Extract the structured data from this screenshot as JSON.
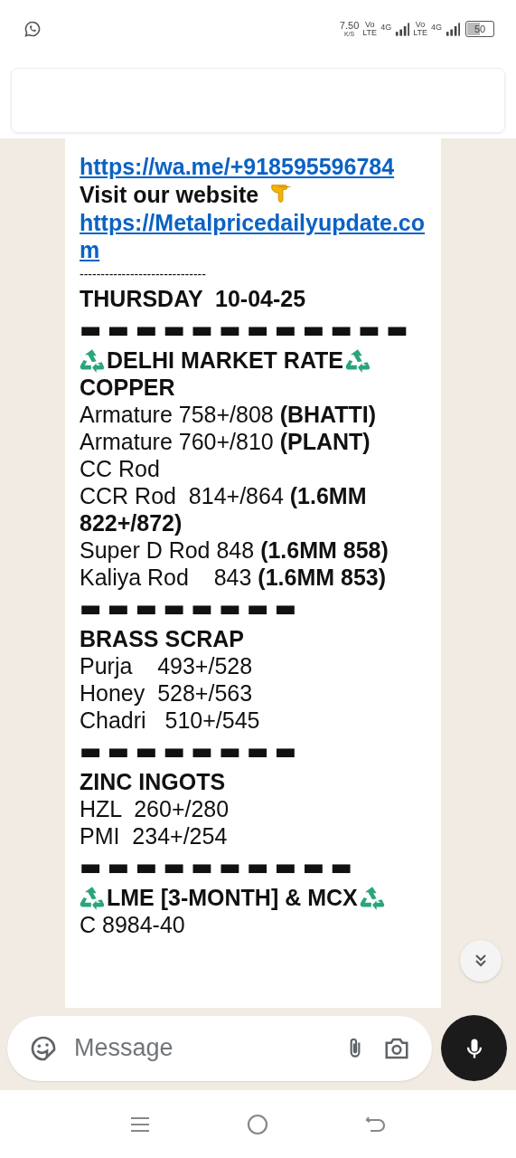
{
  "status_bar": {
    "speed": "7.50",
    "speed_unit": "K/S",
    "sims": [
      {
        "volte_top": "Vo",
        "volte_bottom": "LTE",
        "network": "4G"
      },
      {
        "volte_top": "Vo",
        "volte_bottom": "LTE",
        "network": "4G"
      }
    ],
    "battery": "50"
  },
  "message": {
    "lines": [
      {
        "kind": "link",
        "text": "https://wa.me/+918595596784"
      },
      {
        "kind": "pointer",
        "text": "Visit our website"
      },
      {
        "kind": "link",
        "text": "https://Metalpricedailyupdate.com"
      },
      {
        "kind": "rule",
        "text": "------------------------------"
      },
      {
        "kind": "title",
        "text": "THURSDAY  10-04-25"
      },
      {
        "kind": "bar",
        "text": "▬ ▬ ▬ ▬ ▬ ▬ ▬ ▬ ▬ ▬ ▬ ▬"
      },
      {
        "kind": "heading",
        "text": "DELHI MARKET RATE"
      },
      {
        "kind": "title",
        "text": "COPPER"
      },
      {
        "kind": "text",
        "text": "Armature 758+/808 **(BHATTI)**"
      },
      {
        "kind": "text",
        "text": "Armature 760+/810 **(PLANT)**"
      },
      {
        "kind": "text",
        "text": "CC Rod"
      },
      {
        "kind": "text",
        "text": "CCR Rod  814+/864 **(1.6MM 822+/872)**"
      },
      {
        "kind": "text",
        "text": "Super D Rod 848 **(1.6MM 858)**"
      },
      {
        "kind": "text",
        "text": "Kaliya Rod    843 **(1.6MM 853)**"
      },
      {
        "kind": "bar",
        "text": "▬ ▬ ▬ ▬ ▬ ▬ ▬ ▬"
      },
      {
        "kind": "title",
        "text": "BRASS SCRAP"
      },
      {
        "kind": "text",
        "text": "Purja    493+/528"
      },
      {
        "kind": "text",
        "text": "Honey  528+/563"
      },
      {
        "kind": "text",
        "text": "Chadri   510+/545"
      },
      {
        "kind": "bar",
        "text": "▬ ▬ ▬ ▬ ▬ ▬ ▬ ▬"
      },
      {
        "kind": "title",
        "text": "ZINC INGOTS"
      },
      {
        "kind": "text",
        "text": "HZL  260+/280"
      },
      {
        "kind": "text",
        "text": "PMI  234+/254"
      },
      {
        "kind": "bar",
        "text": "▬ ▬ ▬ ▬ ▬ ▬ ▬ ▬ ▬ ▬"
      },
      {
        "kind": "heading",
        "text": "LME [3-MONTH] & MCX"
      },
      {
        "kind": "text",
        "text": "C 8984-40"
      }
    ]
  },
  "composer": {
    "placeholder": "Message"
  }
}
